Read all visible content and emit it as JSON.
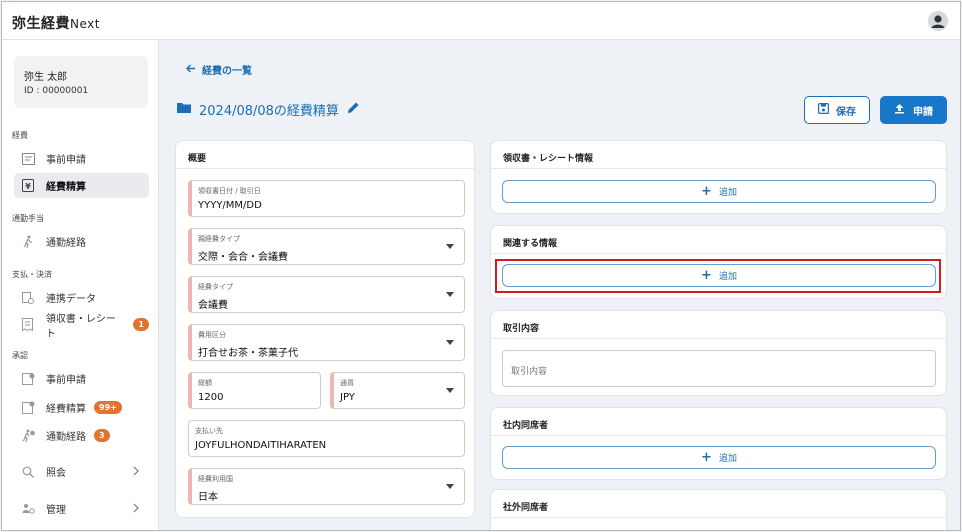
{
  "header": {
    "brand": "弥生経費",
    "brand_suffix": "Next"
  },
  "user": {
    "name": "弥生 太郎",
    "id": "ID : 00000001"
  },
  "sidebar": {
    "sections": [
      "経費",
      "通勤手当",
      "支払・決済",
      "承認"
    ],
    "items": [
      {
        "label": "事前申請"
      },
      {
        "label": "経費精算"
      },
      {
        "label": "通勤経路"
      },
      {
        "label": "連携データ"
      },
      {
        "label": "領収書・レシート",
        "badge": "1"
      },
      {
        "label": "事前申請"
      },
      {
        "label": "経費精算",
        "badge": "99+"
      },
      {
        "label": "通勤経路",
        "badge": "3"
      },
      {
        "label": "照会"
      },
      {
        "label": "管理"
      }
    ]
  },
  "breadcrumb": {
    "back_label": "経費の一覧"
  },
  "page": {
    "title": "2024/08/08の経費精算"
  },
  "actions": {
    "save_label": "保存",
    "apply_label": "申請"
  },
  "overview": {
    "title": "概要",
    "fields": [
      {
        "label": "領収書日付 / 取引日",
        "value": "YYYY/MM/DD"
      },
      {
        "label": "親経費タイプ",
        "value": "交際・会合・会議費"
      },
      {
        "label": "経費タイプ",
        "value": "会議費"
      },
      {
        "label": "費用区分",
        "value": "打合せお茶・茶菓子代"
      },
      {
        "label": "総額",
        "value": "1200"
      },
      {
        "label": "通貨",
        "value": "JPY"
      },
      {
        "label": "支払い先",
        "value": "JOYFULHONDAITIHARATEN"
      },
      {
        "label": "経費利用国",
        "value": "日本"
      }
    ]
  },
  "right_panels": {
    "receipt": {
      "title": "領収書・レシート情報",
      "add_label": "追加"
    },
    "related": {
      "title": "関連する情報",
      "add_label": "追加"
    },
    "transaction": {
      "title": "取引内容",
      "placeholder": "取引内容"
    },
    "internal": {
      "title": "社内同席者",
      "add_label": "追加"
    },
    "external": {
      "title": "社外同席者"
    }
  },
  "colors": {
    "accent": "#1877c9",
    "badge": "#e2742e",
    "highlight": "#d51c1c"
  }
}
